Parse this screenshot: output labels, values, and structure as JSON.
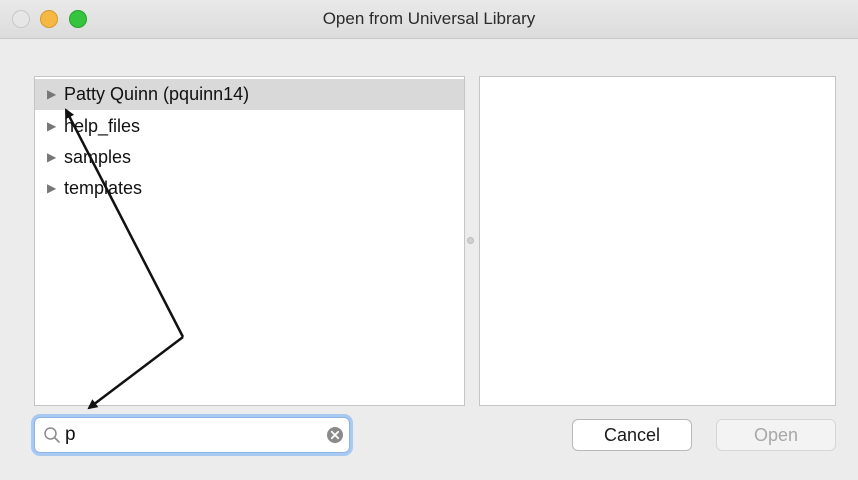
{
  "window": {
    "title": "Open from Universal Library"
  },
  "tree": {
    "items": [
      {
        "label": "Patty Quinn (pquinn14)",
        "selected": true
      },
      {
        "label": "help_files",
        "selected": false
      },
      {
        "label": "samples",
        "selected": false
      },
      {
        "label": "templates",
        "selected": false
      }
    ],
    "disclosure_glyph": "▶"
  },
  "search": {
    "value": "p",
    "icon": "search-icon",
    "clear_icon": "clear-icon"
  },
  "buttons": {
    "cancel_label": "Cancel",
    "open_label": "Open"
  },
  "colors": {
    "focus_ring": "#a8c9f2",
    "selected_row": "#d9d9d9",
    "close_light": "#e6e6e6",
    "minimize_light": "#f5b842",
    "maximize_light": "#35c43d"
  }
}
